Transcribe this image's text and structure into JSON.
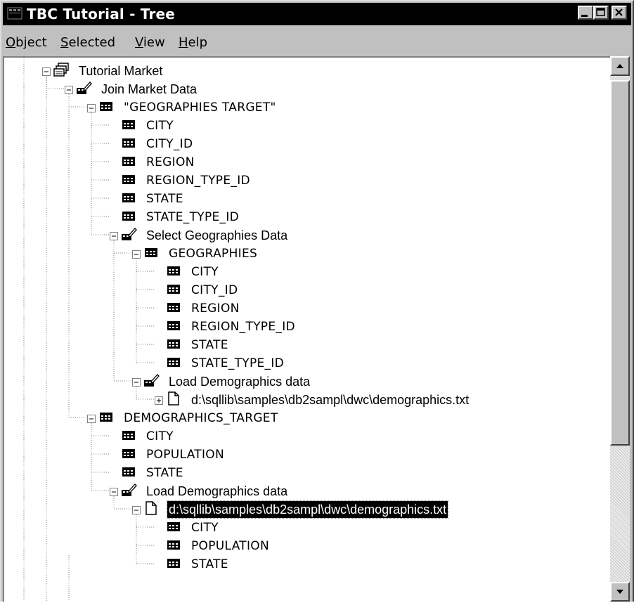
{
  "window": {
    "title": "TBC Tutorial - Tree"
  },
  "menu": [
    {
      "label": "Object",
      "accel": "O"
    },
    {
      "label": "Selected",
      "accel": "S"
    },
    {
      "label": "View",
      "accel": "V"
    },
    {
      "label": "Help",
      "accel": "H"
    }
  ],
  "tree": [
    {
      "label": "Tutorial Market",
      "level": 0,
      "icon": "market-icon",
      "expander": "minus"
    },
    {
      "label": "Join Market Data",
      "level": 1,
      "icon": "step-icon",
      "expander": "minus"
    },
    {
      "label": "\"GEOGRAPHIES TARGET\"",
      "level": 2,
      "icon": "table-icon",
      "expander": "minus"
    },
    {
      "label": "CITY",
      "level": 3,
      "icon": "column-icon"
    },
    {
      "label": "CITY_ID",
      "level": 3,
      "icon": "column-icon"
    },
    {
      "label": "REGION",
      "level": 3,
      "icon": "column-icon"
    },
    {
      "label": "REGION_TYPE_ID",
      "level": 3,
      "icon": "column-icon"
    },
    {
      "label": "STATE",
      "level": 3,
      "icon": "column-icon"
    },
    {
      "label": "STATE_TYPE_ID",
      "level": 3,
      "icon": "column-icon"
    },
    {
      "label": "Select Geographies Data",
      "level": 3,
      "icon": "step-icon",
      "expander": "minus"
    },
    {
      "label": "GEOGRAPHIES",
      "level": 4,
      "icon": "table-icon",
      "expander": "minus"
    },
    {
      "label": "CITY",
      "level": 5,
      "icon": "column-icon"
    },
    {
      "label": "CITY_ID",
      "level": 5,
      "icon": "column-icon"
    },
    {
      "label": "REGION",
      "level": 5,
      "icon": "column-icon"
    },
    {
      "label": "REGION_TYPE_ID",
      "level": 5,
      "icon": "column-icon"
    },
    {
      "label": "STATE",
      "level": 5,
      "icon": "column-icon"
    },
    {
      "label": "STATE_TYPE_ID",
      "level": 5,
      "icon": "column-icon"
    },
    {
      "label": "Load Demographics data",
      "level": 4,
      "icon": "step-icon",
      "expander": "minus"
    },
    {
      "label": "d:\\sqllib\\samples\\db2sampl\\dwc\\demographics.txt",
      "level": 5,
      "icon": "file-icon",
      "expander": "plus"
    },
    {
      "label": "DEMOGRAPHICS_TARGET",
      "level": 2,
      "icon": "table-icon",
      "expander": "minus"
    },
    {
      "label": "CITY",
      "level": 3,
      "icon": "column-icon"
    },
    {
      "label": "POPULATION",
      "level": 3,
      "icon": "column-icon"
    },
    {
      "label": "STATE",
      "level": 3,
      "icon": "column-icon"
    },
    {
      "label": "Load Demographics data",
      "level": 3,
      "icon": "step-icon",
      "expander": "minus"
    },
    {
      "label": "d:\\sqllib\\samples\\db2sampl\\dwc\\demographics.txt",
      "level": 4,
      "icon": "file-icon",
      "expander": "minus",
      "selected": true
    },
    {
      "label": "CITY",
      "level": 5,
      "icon": "column-icon"
    },
    {
      "label": "POPULATION",
      "level": 5,
      "icon": "column-icon"
    },
    {
      "label": "STATE",
      "level": 5,
      "icon": "column-icon"
    }
  ]
}
